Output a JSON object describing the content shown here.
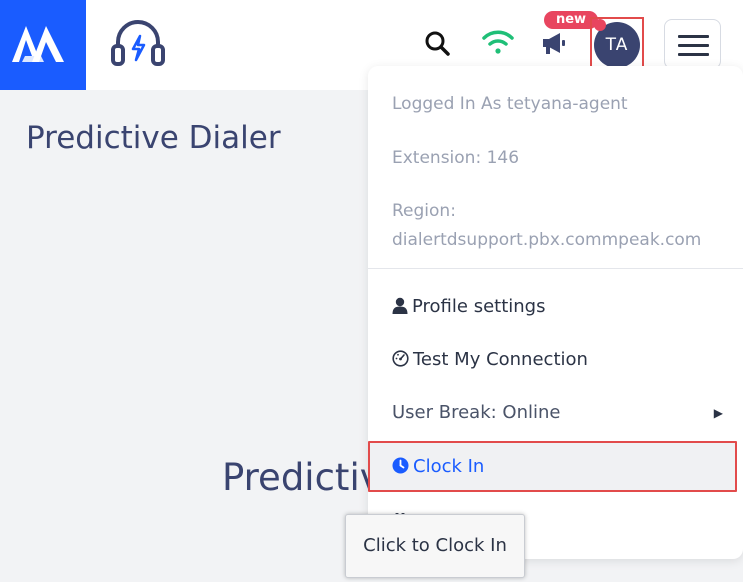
{
  "header": {
    "new_badge": "new",
    "avatar_initials": "TA",
    "accent_color": "#1a5cff",
    "wifi_color": "#1fbf77"
  },
  "page": {
    "title": "Predictive Dialer",
    "big_title": "Predictive Dialer"
  },
  "user_menu": {
    "logged_in": "Logged In As tetyana-agent",
    "extension": "Extension: 146",
    "region_label": "Region:",
    "region_value": "dialertdsupport.pbx.commpeak.com",
    "items": [
      {
        "label": "Profile settings",
        "icon": "user-icon"
      },
      {
        "label": "Test My Connection",
        "icon": "gauge-icon"
      },
      {
        "label": "User Break: Online",
        "icon": "chevron-right-icon"
      },
      {
        "label": "Clock In",
        "icon": "clock-icon"
      }
    ]
  },
  "tooltip": {
    "text": "Click to Clock In"
  }
}
